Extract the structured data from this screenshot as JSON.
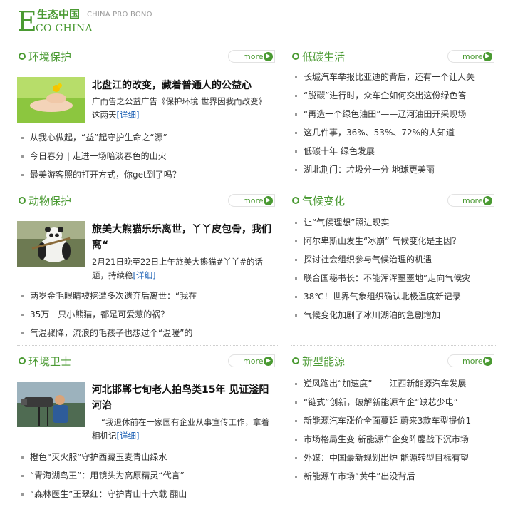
{
  "brand": {
    "letter": "E",
    "name_cn": "生态中国",
    "sub_en": "CHINA PRO BONO",
    "name_en": "CO CHINA"
  },
  "more_label": "more",
  "sections": [
    {
      "title": "环境保护",
      "feature": {
        "title": "北盘江的改变，藏着普通人的公益心",
        "summary": "广而告之公益广告《保护环境 世界因我而改变》这两天",
        "detail": "[详细]"
      },
      "items": [
        "从我心做起，“益”起守护生命之“源”",
        "今日春分 | 走进一场暗淡春色的山火",
        "最美游客照的打开方式，你get到了吗？"
      ]
    },
    {
      "title": "低碳生活",
      "items": [
        "长城汽车举报比亚迪的背后，还有一个让人关",
        "“脱碳”进行时，众车企如何交出这份绿色答",
        "“再造一个绿色油田”——辽河油田开采现场",
        "这几件事，36%、53%、72%的人知道",
        "低碳十年 绿色发展",
        "湖北荆门：垃圾分一分 地球更美丽"
      ]
    },
    {
      "title": "动物保护",
      "feature": {
        "title": "旅美大熊猫乐乐离世，丫丫皮包骨，我们离“",
        "summary": "2月21日晚至22日上午旅美大熊猫#丫丫#的话题，持续稳",
        "detail": "[详细]"
      },
      "items": [
        "两岁金毛眼睛被挖遭多次遗弃后离世：“我在",
        "35万一只小熊猫，都是可爱惹的祸？",
        "气温骤降，流浪的毛孩子也想过个“温暖”的"
      ]
    },
    {
      "title": "气候变化",
      "items": [
        "让“气候理想”照进现实",
        "阿尔卑斯山发生“冰崩” 气候变化是主因？",
        "探讨社会组织参与气候治理的机遇",
        "联合国秘书长：不能浑浑噩噩地”走向气候灾",
        "38℃！世界气象组织确认北极温度新记录",
        "气候变化加剧了冰川湖泊的急剧增加"
      ]
    },
    {
      "title": "环境卫士",
      "feature": {
        "title": "河北邯郸七旬老人拍鸟类15年 见证滏阳河治",
        "summary": "“我退休前在一家国有企业从事宣传工作，拿着相机记",
        "detail": "[详细]"
      },
      "items": [
        "橙色“灭火服”守护西藏玉麦青山绿水",
        "“青海湖鸟王”：用镜头为高原精灵“代言”",
        "“森林医生”王翠红：守护青山十六载 翻山"
      ]
    },
    {
      "title": "新型能源",
      "items": [
        "逆风跑出“加速度”——江西新能源汽车发展",
        "“链式”创新，破解新能源车企“缺芯少电”",
        "新能源汽车涨价全面蔓延 蔚来3款车型提价1",
        "市场格局生变 新能源车企变阵鏖战下沉市场",
        "外媒：中国最新规划出炉 能源转型目标有望",
        "新能源车市场“黄牛”出没背后"
      ]
    }
  ]
}
